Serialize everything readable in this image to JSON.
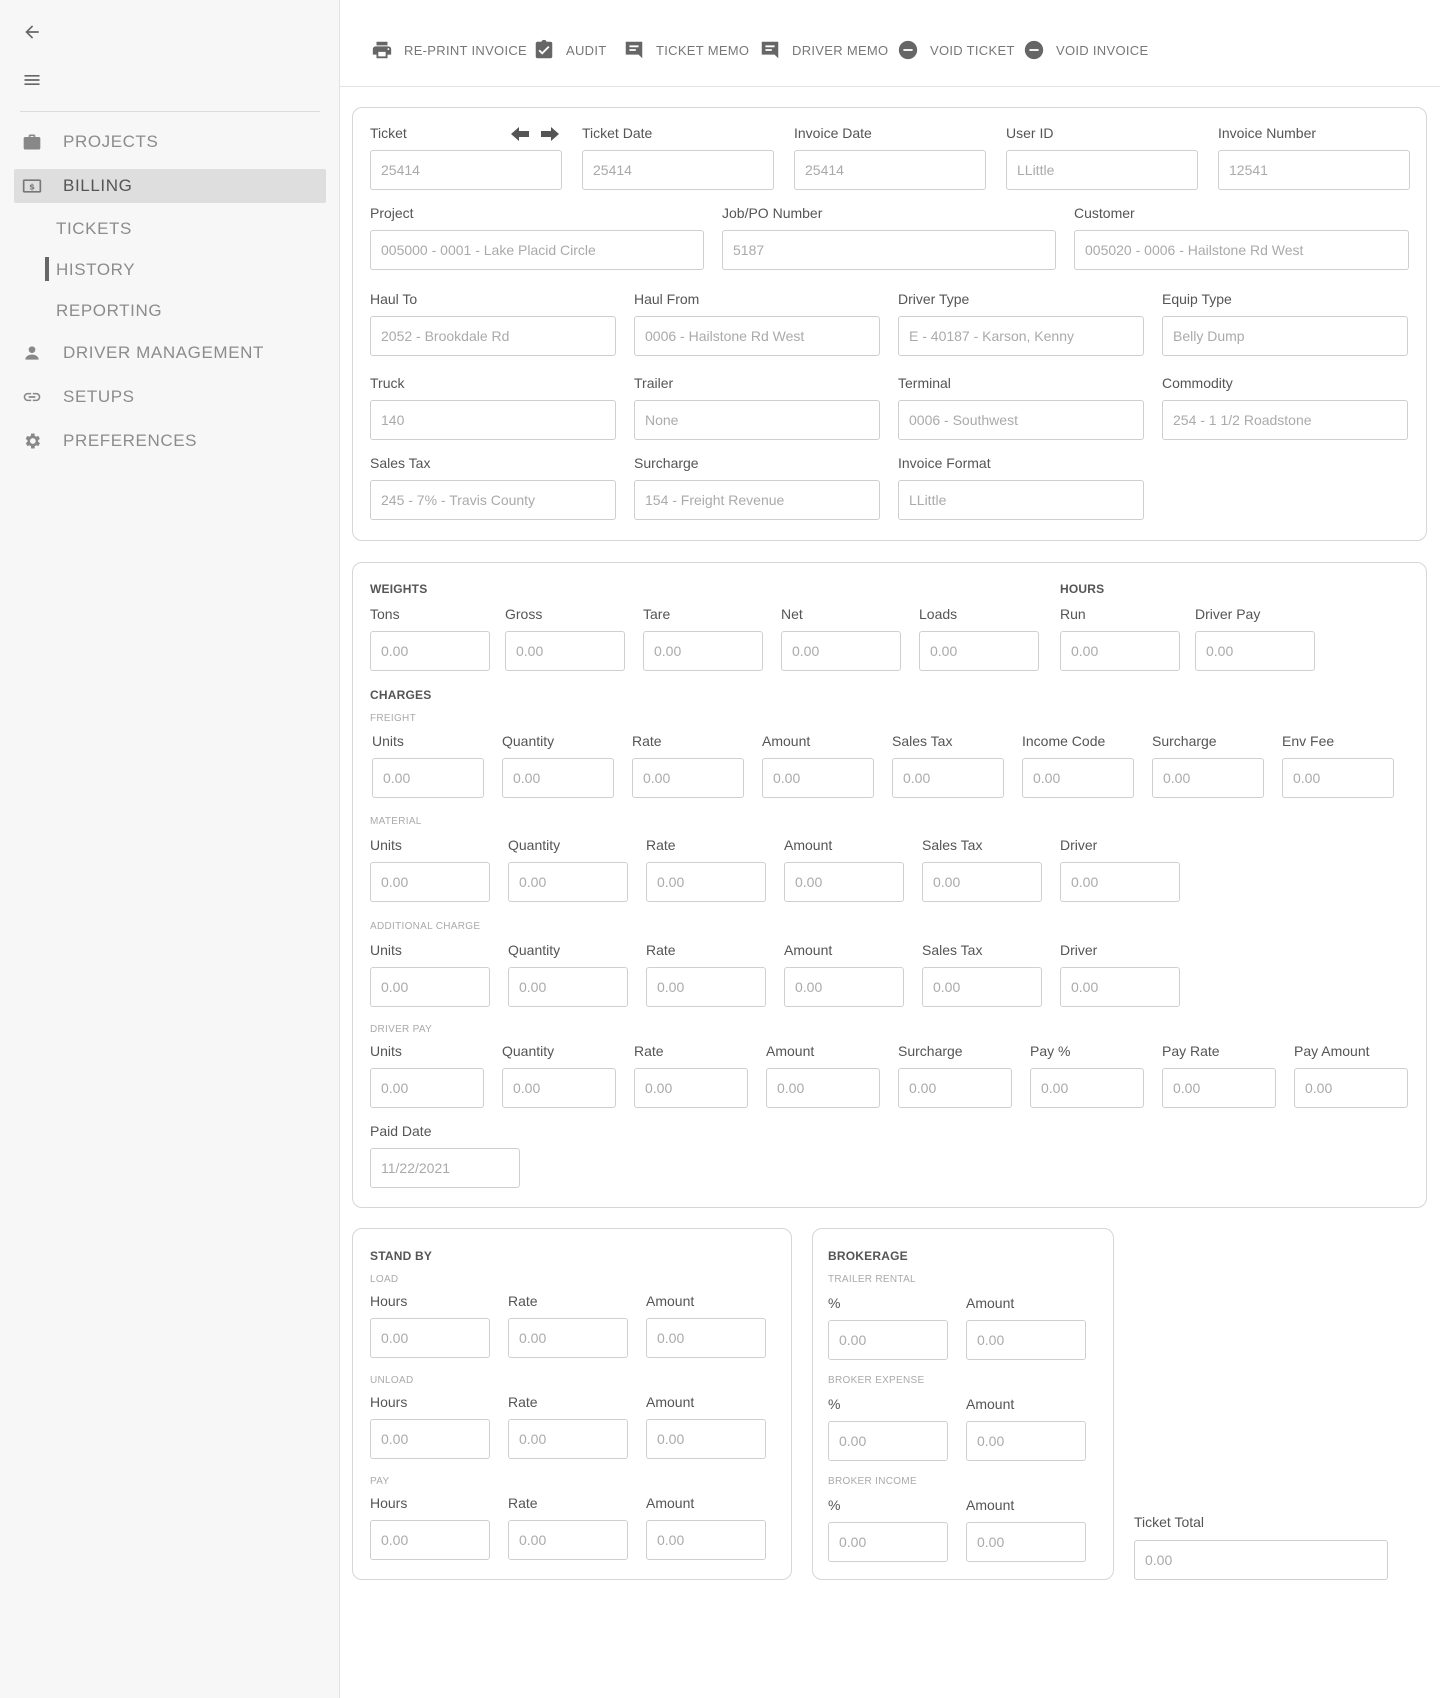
{
  "sidebar": {
    "nav": {
      "projects": "PROJECTS",
      "billing": "BILLING",
      "tickets": "TICKETS",
      "history": "HISTORY",
      "reporting": "REPORTING",
      "driver_management": "DRIVER MANAGEMENT",
      "setups": "SETUPS",
      "preferences": "PREFERENCES"
    }
  },
  "toolbar": {
    "reprint": "RE-PRINT INVOICE",
    "audit": "AUDIT",
    "ticket_memo": "TICKET MEMO",
    "driver_memo": "DRIVER MEMO",
    "void_ticket": "VOID TICKET",
    "void_invoice": "VOID INVOICE"
  },
  "header": {
    "labels": {
      "ticket": "Ticket",
      "ticket_date": "Ticket Date",
      "invoice_date": "Invoice Date",
      "user_id": "User ID",
      "invoice_number": "Invoice Number",
      "project": "Project",
      "job_po": "Job/PO Number",
      "customer": "Customer",
      "haul_to": "Haul To",
      "haul_from": "Haul From",
      "driver_type": "Driver Type",
      "equip_type": "Equip Type",
      "truck": "Truck",
      "trailer": "Trailer",
      "terminal": "Terminal",
      "commodity": "Commodity",
      "sales_tax": "Sales Tax",
      "surcharge": "Surcharge",
      "invoice_format": "Invoice Format"
    },
    "values": {
      "ticket": "25414",
      "ticket_date": "25414",
      "invoice_date": "25414",
      "user_id": "LLittle",
      "invoice_number": "12541",
      "project": "005000 - 0001 - Lake Placid Circle",
      "job_po": "5187",
      "customer": "005020 - 0006 - Hailstone Rd West",
      "haul_to": "2052 - Brookdale Rd",
      "haul_from": "0006 - Hailstone Rd West",
      "driver_type": "E - 40187 - Karson, Kenny",
      "equip_type": "Belly Dump",
      "truck": "140",
      "trailer": "None",
      "terminal": "0006 - Southwest",
      "commodity": "254 - 1 1/2 Roadstone",
      "sales_tax": "245 - 7% - Travis County",
      "surcharge": "154 - Freight Revenue",
      "invoice_format": "LLittle"
    }
  },
  "weights": {
    "title": "WEIGHTS",
    "labels": {
      "tons": "Tons",
      "gross": "Gross",
      "tare": "Tare",
      "net": "Net",
      "loads": "Loads"
    },
    "values": {
      "tons": "0.00",
      "gross": "0.00",
      "tare": "0.00",
      "net": "0.00",
      "loads": "0.00"
    }
  },
  "hours": {
    "title": "HOURS",
    "labels": {
      "run": "Run",
      "driver_pay": "Driver Pay"
    },
    "values": {
      "run": "0.00",
      "driver_pay": "0.00"
    }
  },
  "charges": {
    "title": "CHARGES",
    "freight": {
      "title": "FREIGHT",
      "labels": {
        "units": "Units",
        "quantity": "Quantity",
        "rate": "Rate",
        "amount": "Amount",
        "sales_tax": "Sales Tax",
        "income_code": "Income Code",
        "surcharge": "Surcharge",
        "env_fee": "Env Fee"
      },
      "values": {
        "units": "0.00",
        "quantity": "0.00",
        "rate": "0.00",
        "amount": "0.00",
        "sales_tax": "0.00",
        "income_code": "0.00",
        "surcharge": "0.00",
        "env_fee": "0.00"
      }
    },
    "material": {
      "title": "MATERIAL",
      "labels": {
        "units": "Units",
        "quantity": "Quantity",
        "rate": "Rate",
        "amount": "Amount",
        "sales_tax": "Sales Tax",
        "driver": "Driver"
      },
      "values": {
        "units": "0.00",
        "quantity": "0.00",
        "rate": "0.00",
        "amount": "0.00",
        "sales_tax": "0.00",
        "driver": "0.00"
      }
    },
    "additional": {
      "title": "ADDITIONAL CHARGE",
      "labels": {
        "units": "Units",
        "quantity": "Quantity",
        "rate": "Rate",
        "amount": "Amount",
        "sales_tax": "Sales Tax",
        "driver": "Driver"
      },
      "values": {
        "units": "0.00",
        "quantity": "0.00",
        "rate": "0.00",
        "amount": "0.00",
        "sales_tax": "0.00",
        "driver": "0.00"
      }
    },
    "driver_pay": {
      "title": "DRIVER PAY",
      "labels": {
        "units": "Units",
        "quantity": "Quantity",
        "rate": "Rate",
        "amount": "Amount",
        "surcharge": "Surcharge",
        "pay_pct": "Pay %",
        "pay_rate": "Pay Rate",
        "pay_amount": "Pay Amount"
      },
      "values": {
        "units": "0.00",
        "quantity": "0.00",
        "rate": "0.00",
        "amount": "0.00",
        "surcharge": "0.00",
        "pay_pct": "0.00",
        "pay_rate": "0.00",
        "pay_amount": "0.00"
      }
    },
    "paid_date_label": "Paid Date",
    "paid_date": "11/22/2021"
  },
  "standby": {
    "title": "STAND BY",
    "load": {
      "title": "LOAD",
      "hours_label": "Hours",
      "rate_label": "Rate",
      "amount_label": "Amount",
      "hours": "0.00",
      "rate": "0.00",
      "amount": "0.00"
    },
    "unload": {
      "title": "UNLOAD",
      "hours_label": "Hours",
      "rate_label": "Rate",
      "amount_label": "Amount",
      "hours": "0.00",
      "rate": "0.00",
      "amount": "0.00"
    },
    "pay": {
      "title": "PAY",
      "hours_label": "Hours",
      "rate_label": "Rate",
      "amount_label": "Amount",
      "hours": "0.00",
      "rate": "0.00",
      "amount": "0.00"
    }
  },
  "brokerage": {
    "title": "BROKERAGE",
    "trailer_rental": {
      "title": "TRAILER RENTAL",
      "pct_label": "%",
      "amount_label": "Amount",
      "pct": "0.00",
      "amount": "0.00"
    },
    "broker_expense": {
      "title": "BROKER EXPENSE",
      "pct_label": "%",
      "amount_label": "Amount",
      "pct": "0.00",
      "amount": "0.00"
    },
    "broker_income": {
      "title": "BROKER INCOME",
      "pct_label": "%",
      "amount_label": "Amount",
      "pct": "0.00",
      "amount": "0.00"
    }
  },
  "ticket_total": {
    "label": "Ticket Total",
    "value": "0.00"
  },
  "colors": {
    "sidebar_bg": "#f7f7f7",
    "active_bg": "#dedede",
    "border": "#d6d6d6",
    "icon": "#666666"
  }
}
